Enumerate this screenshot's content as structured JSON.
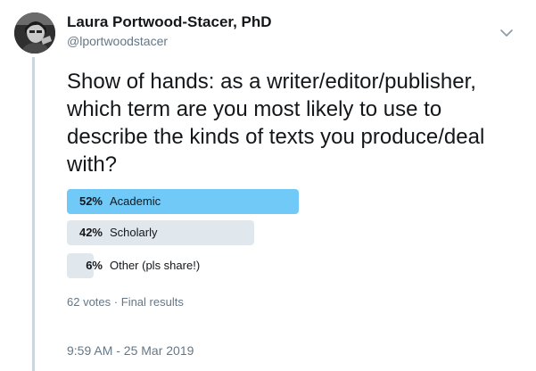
{
  "author": {
    "name": "Laura Portwood-Stacer, PhD",
    "handle": "@lportwoodstacer"
  },
  "tweet": {
    "text": "Show of hands: as a writer/editor/publisher, which term are you most likely to use to describe the kinds of texts you produce/deal with?"
  },
  "poll": {
    "options": [
      {
        "percent_label": "52%",
        "percent": 52,
        "label": "Academic",
        "winner": true
      },
      {
        "percent_label": "42%",
        "percent": 42,
        "label": "Scholarly",
        "winner": false
      },
      {
        "percent_label": "6%",
        "percent": 6,
        "label": "Other (pls share!)",
        "winner": false
      }
    ],
    "votes": "62 votes",
    "separator": "·",
    "status": "Final results"
  },
  "timestamp": "9:59 AM - 25 Mar 2019",
  "icons": {
    "menu": "chevron-down-icon"
  },
  "colors": {
    "winner_bar": "#71c9f8",
    "other_bar": "#e1e8ed",
    "secondary_text": "#657786"
  }
}
